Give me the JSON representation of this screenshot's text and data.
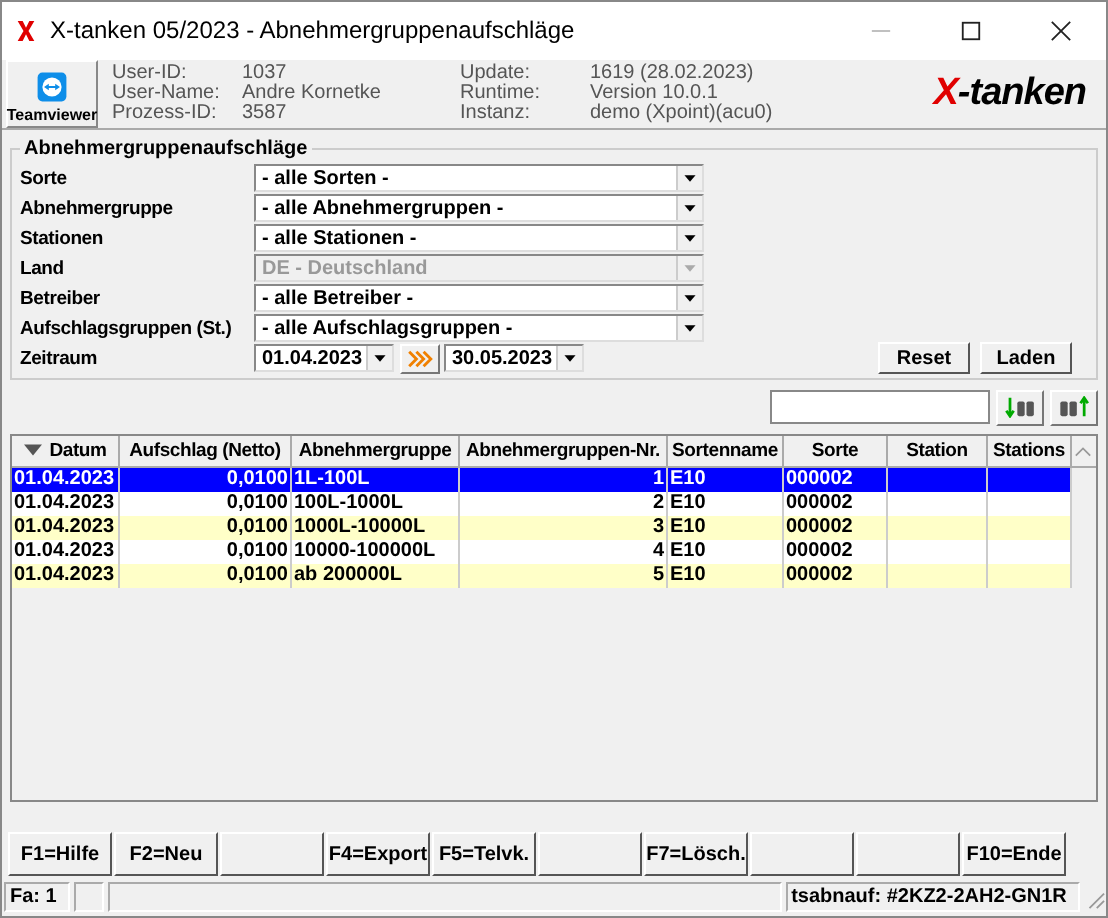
{
  "window": {
    "title": "X-tanken 05/2023 - Abnehmergruppenaufschläge"
  },
  "header": {
    "teamviewer": "Teamviewer",
    "info": [
      {
        "label": "User-ID:",
        "value": "1037"
      },
      {
        "label": "User-Name:",
        "value": "Andre Kornetke"
      },
      {
        "label": "Prozess-ID:",
        "value": "3587"
      },
      {
        "label": "Update:",
        "value": "1619 (28.02.2023)"
      },
      {
        "label": "Runtime:",
        "value": "Version 10.0.1"
      },
      {
        "label": "Instanz:",
        "value": "demo (Xpoint)(acu0)"
      }
    ],
    "logo_mark": "X",
    "logo_text": "-tanken"
  },
  "filter": {
    "title": "Abnehmergruppenaufschläge",
    "fields": [
      {
        "label": "Sorte",
        "value": "- alle Sorten -",
        "disabled": false
      },
      {
        "label": "Abnehmergruppe",
        "value": "- alle Abnehmergruppen -",
        "disabled": false
      },
      {
        "label": "Stationen",
        "value": "- alle Stationen -",
        "disabled": false
      },
      {
        "label": "Land",
        "value": "DE - Deutschland",
        "disabled": true
      },
      {
        "label": "Betreiber",
        "value": "- alle Betreiber -",
        "disabled": false
      },
      {
        "label": "Aufschlagsgruppen (St.)",
        "value": "- alle Aufschlagsgruppen -",
        "disabled": false
      }
    ],
    "period": {
      "label": "Zeitraum",
      "from": "01.04.2023",
      "to": "30.05.2023"
    },
    "buttons": [
      "Reset",
      "Laden"
    ]
  },
  "table": {
    "columns": [
      "Datum",
      "Aufschlag (Netto)",
      "Abnehmergruppe",
      "Abnehmergruppen-Nr.",
      "Sortenname",
      "Sorte",
      "Station",
      "Stations"
    ],
    "rows": [
      {
        "selected": true,
        "cells": [
          "01.04.2023",
          "0,0100",
          "1L-100L",
          "1",
          "E10",
          "000002"
        ]
      },
      {
        "selected": false,
        "cells": [
          "01.04.2023",
          "0,0100",
          "100L-1000L",
          "2",
          "E10",
          "000002"
        ]
      },
      {
        "selected": false,
        "cells": [
          "01.04.2023",
          "0,0100",
          "1000L-10000L",
          "3",
          "E10",
          "000002"
        ]
      },
      {
        "selected": false,
        "cells": [
          "01.04.2023",
          "0,0100",
          "10000-100000L",
          "4",
          "E10",
          "000002"
        ]
      },
      {
        "selected": false,
        "cells": [
          "01.04.2023",
          "0,0100",
          "ab 200000L",
          "5",
          "E10",
          "000002"
        ]
      }
    ]
  },
  "function_keys": [
    {
      "kind": "key",
      "label": "F1=Hilfe"
    },
    {
      "kind": "key",
      "label": "F2=Neu"
    },
    {
      "kind": "blank"
    },
    {
      "kind": "key",
      "label": "F4=Export"
    },
    {
      "kind": "key",
      "label": "F5=Telvk."
    },
    {
      "kind": "blank"
    },
    {
      "kind": "key",
      "label": "F7=Lösch."
    },
    {
      "kind": "blank"
    },
    {
      "kind": "blank"
    },
    {
      "kind": "key",
      "label": "F10=Ende"
    }
  ],
  "status_bar": {
    "left": "Fa: 1",
    "right": "tsabnauf: #2KZ2-2AH2-GN1R"
  }
}
